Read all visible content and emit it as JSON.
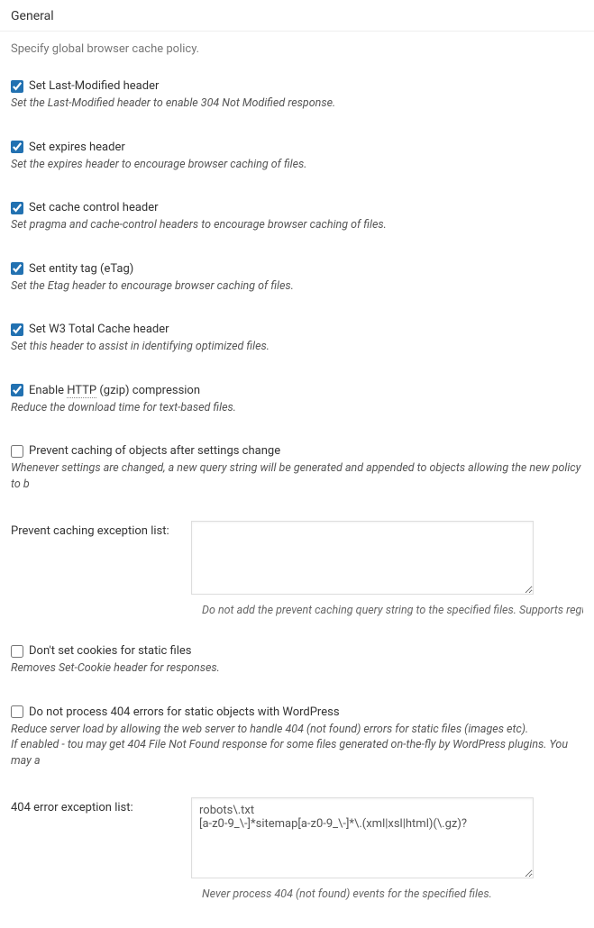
{
  "section": {
    "title": "General",
    "subtitle": "Specify global browser cache policy."
  },
  "options": {
    "lastModified": {
      "label": "Set Last-Modified header",
      "desc": "Set the Last-Modified header to enable 304 Not Modified response.",
      "checked": true
    },
    "expires": {
      "label": "Set expires header",
      "desc": "Set the expires header to encourage browser caching of files.",
      "checked": true
    },
    "cacheControl": {
      "label": "Set cache control header",
      "desc": "Set pragma and cache-control headers to encourage browser caching of files.",
      "checked": true
    },
    "etag": {
      "label": "Set entity tag (eTag)",
      "desc": "Set the Etag header to encourage browser caching of files.",
      "checked": true
    },
    "w3tc": {
      "label": "Set W3 Total Cache header",
      "desc": "Set this header to assist in identifying optimized files.",
      "checked": true
    },
    "gzip": {
      "label_pre": "Enable ",
      "label_abbr": "HTTP",
      "label_post": " (gzip) compression",
      "desc": "Reduce the download time for text-based files.",
      "checked": true
    },
    "preventCaching": {
      "label": "Prevent caching of objects after settings change",
      "desc": "Whenever settings are changed, a new query string will be generated and appended to objects allowing the new policy to b",
      "checked": false
    },
    "noCookies": {
      "label": "Don't set cookies for static files",
      "desc": "Removes Set-Cookie header for responses.",
      "checked": false
    },
    "no404": {
      "label": "Do not process 404 errors for static objects with WordPress",
      "desc_line1": "Reduce server load by allowing the web server to handle 404 (not found) errors for static files (images etc).",
      "desc_line2": "If enabled - tou may get 404 File Not Found response for some files generated on-the-fly by WordPress plugins. You may a",
      "checked": false
    }
  },
  "fields": {
    "preventList": {
      "label": "Prevent caching exception list:",
      "value": "",
      "hint": "Do not add the prevent caching query string to the specified files. Supports regular ex"
    },
    "errorList": {
      "label": "404 error exception list:",
      "value": "robots\\.txt\n[a-z0-9_\\-]*sitemap[a-z0-9_\\-]*\\.(xml|xsl|html)(\\.gz)?",
      "hint": "Never process 404 (not found) events for the specified files."
    }
  }
}
